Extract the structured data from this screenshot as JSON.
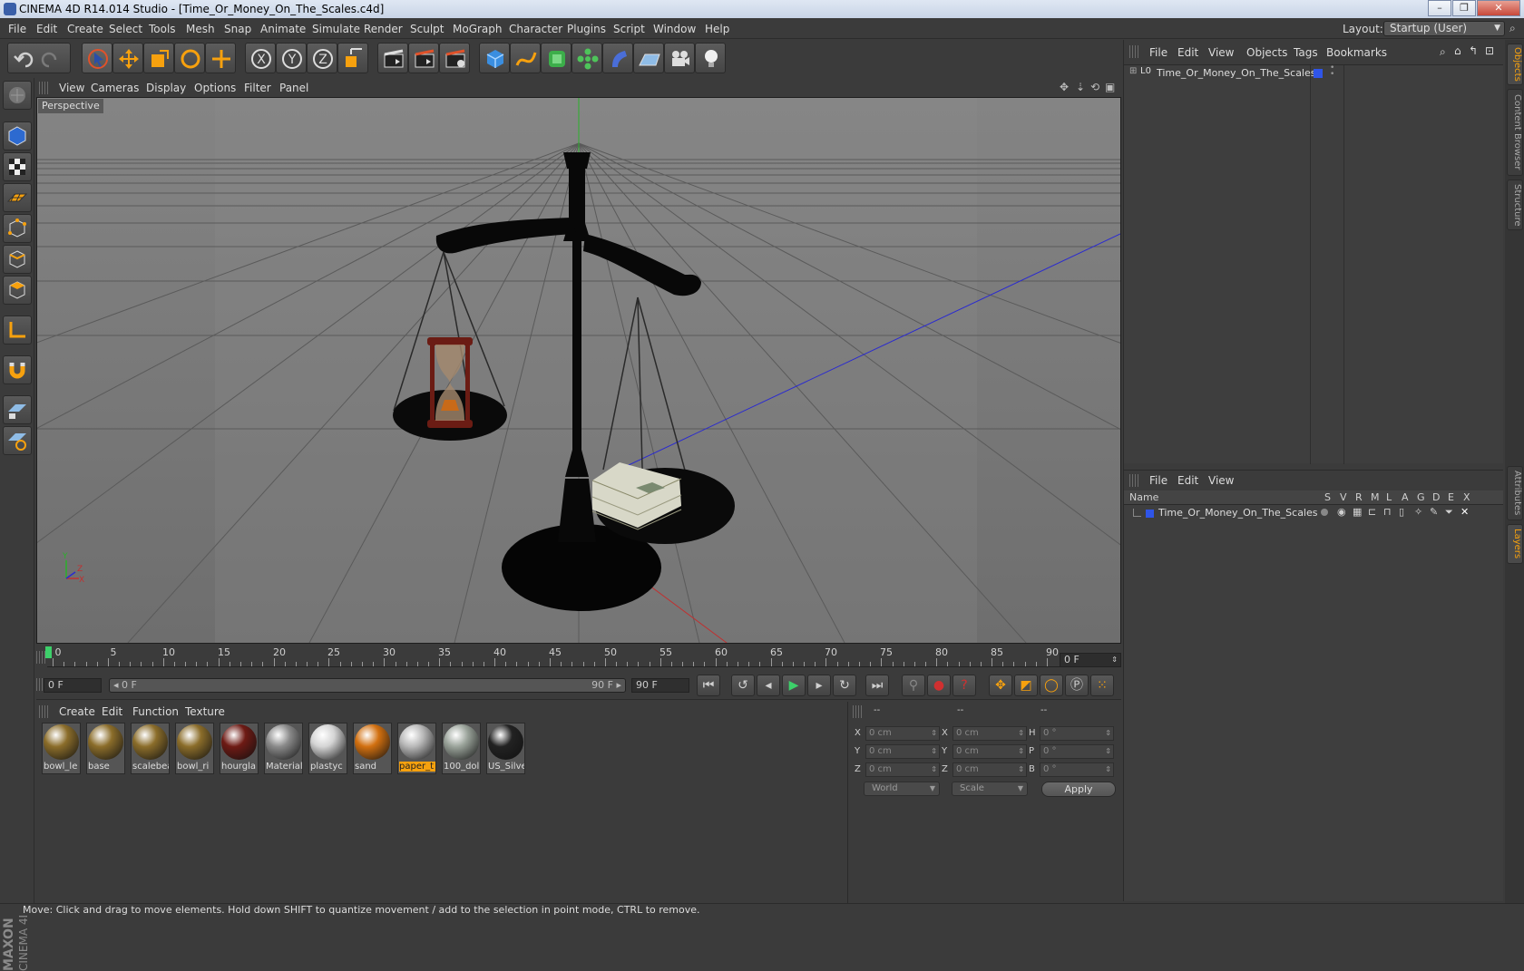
{
  "window": {
    "title": "CINEMA 4D R14.014 Studio - [Time_Or_Money_On_The_Scales.c4d]",
    "controls": {
      "minimize": "–",
      "maximize": "❐",
      "close": "✕"
    }
  },
  "menubar": {
    "items": [
      "File",
      "Edit",
      "Create",
      "Select",
      "Tools",
      "Mesh",
      "Snap",
      "Animate",
      "Simulate",
      "Render",
      "Sculpt",
      "MoGraph",
      "Character",
      "Plugins",
      "Script",
      "Window",
      "Help"
    ],
    "layout_label": "Layout:",
    "layout_value": "Startup (User)"
  },
  "viewport": {
    "menu": [
      "View",
      "Cameras",
      "Display",
      "Options",
      "Filter",
      "Panel"
    ],
    "camera_label": "Perspective",
    "axis_labels": {
      "y": "Y",
      "x": "X",
      "z": "Z"
    }
  },
  "timeline": {
    "ticks": [
      "0",
      "5",
      "10",
      "15",
      "20",
      "25",
      "30",
      "35",
      "40",
      "45",
      "50",
      "55",
      "60",
      "65",
      "70",
      "75",
      "80",
      "85",
      "90"
    ],
    "current_frame": "0 F",
    "start_field": "0 F",
    "range_start": "◂ 0 F",
    "range_end": "90 F ▸",
    "end_field": "90 F"
  },
  "material_manager": {
    "menu": [
      "Create",
      "Edit",
      "Function",
      "Texture"
    ],
    "materials": [
      {
        "name": "bowl_le",
        "color": "#8b6d2a"
      },
      {
        "name": "base",
        "color": "#8b6d2a"
      },
      {
        "name": "scalebea",
        "color": "#8b6d2a"
      },
      {
        "name": "bowl_ri",
        "color": "#8b6d2a"
      },
      {
        "name": "hourgla",
        "color": "#6e1a14"
      },
      {
        "name": "Material",
        "color": "#8a8a8a"
      },
      {
        "name": "plastyc",
        "color": "#d4d4d4"
      },
      {
        "name": "sand",
        "color": "#d27010"
      },
      {
        "name": "paper_t",
        "color": "#b8b8b8"
      },
      {
        "name": "100_dol",
        "color": "#9aa39a"
      },
      {
        "name": "US_Silve",
        "color": "#222222"
      }
    ],
    "selected": "paper_t"
  },
  "coordinates": {
    "headers": [
      "--",
      "--",
      "--"
    ],
    "rows": [
      {
        "a": "X",
        "av": "0 cm",
        "b": "X",
        "bv": "0 cm",
        "c": "H",
        "cv": "0 °"
      },
      {
        "a": "Y",
        "av": "0 cm",
        "b": "Y",
        "bv": "0 cm",
        "c": "P",
        "cv": "0 °"
      },
      {
        "a": "Z",
        "av": "0 cm",
        "b": "Z",
        "bv": "0 cm",
        "c": "B",
        "cv": "0 °"
      }
    ],
    "space": "World",
    "mode": "Scale",
    "apply": "Apply"
  },
  "object_manager": {
    "menu": [
      "File",
      "Edit",
      "View",
      "Objects",
      "Tags",
      "Bookmarks"
    ],
    "object_name": "Time_Or_Money_On_The_Scales",
    "object_prefix": "L0"
  },
  "layer_manager": {
    "menu": [
      "File",
      "Edit",
      "View"
    ],
    "columns": [
      "Name",
      "S",
      "V",
      "R",
      "M",
      "L",
      "A",
      "G",
      "D",
      "E",
      "X"
    ],
    "layer_name": "Time_Or_Money_On_The_Scales"
  },
  "side_tabs": [
    "Objects",
    "Content Browser",
    "Structure",
    "Attributes",
    "Layers"
  ],
  "logo": {
    "brand": "MAXON",
    "product": "CINEMA 4D"
  },
  "status": "Move: Click and drag to move elements. Hold down SHIFT to quantize movement / add to the selection in point mode, CTRL to remove.",
  "colors": {
    "accent": "#f7a10e",
    "layer_blue": "#2f55e8"
  }
}
